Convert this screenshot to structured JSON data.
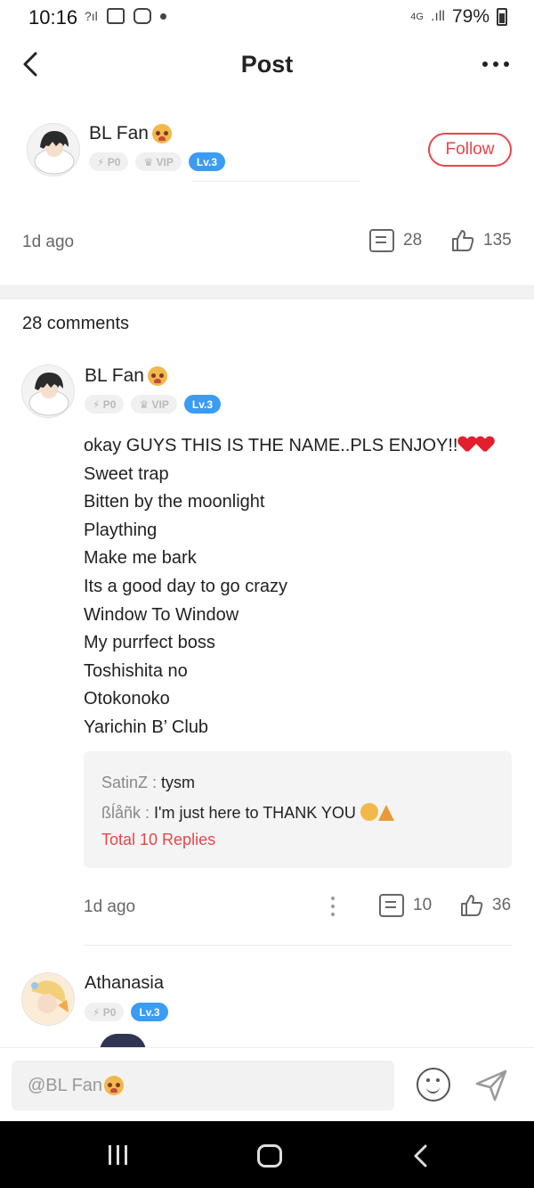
{
  "status_bar": {
    "time": "10:16",
    "battery": "79%",
    "network": "4G"
  },
  "header": {
    "title": "Post"
  },
  "author": {
    "name": "BL Fan",
    "badges": {
      "points": "P0",
      "vip": "VIP",
      "level": "Lv.3"
    },
    "follow_label": "Follow"
  },
  "post_meta": {
    "time": "1d ago",
    "comments": "28",
    "likes": "135"
  },
  "comments_heading": "28 comments",
  "comment": {
    "name": "BL Fan",
    "badges": {
      "points": "P0",
      "vip": "VIP",
      "level": "Lv.3"
    },
    "body_first": "okay GUYS THIS IS THE NAME..PLS ENJOY!!",
    "body_lines": [
      "Sweet trap",
      "Bitten by the moonlight",
      "Plaything",
      "Make me bark",
      "Its a good day to go crazy",
      "Window To Window",
      "My purrfect boss",
      "Toshishita no",
      "Otokonoko",
      "Yarichin B’ Club"
    ],
    "replies": [
      {
        "user": "SatinZ",
        "text": "tysm"
      },
      {
        "user": "ßĺåñk",
        "text": "I'm just here to THANK YOU"
      }
    ],
    "total_replies": "Total 10 Replies",
    "time": "1d ago",
    "comment_count": "10",
    "like_count": "36"
  },
  "comment2": {
    "name": "Athanasia",
    "badges": {
      "points": "P0",
      "level": "Lv.3"
    }
  },
  "input": {
    "mention": "@BL Fan"
  }
}
